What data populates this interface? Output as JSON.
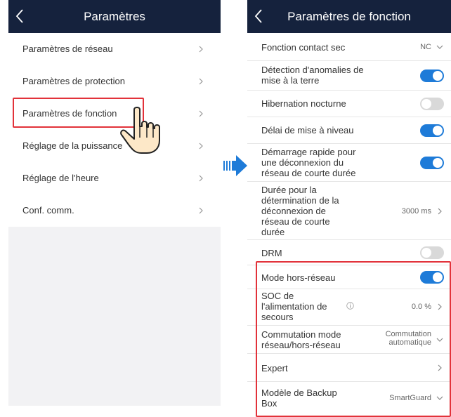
{
  "left": {
    "title": "Paramètres",
    "items": [
      {
        "label": "Paramètres de réseau"
      },
      {
        "label": "Paramètres de protection"
      },
      {
        "label": "Paramètres de fonction"
      },
      {
        "label": "Réglage de la puissance"
      },
      {
        "label": "Réglage de l'heure"
      },
      {
        "label": "Conf. comm."
      }
    ]
  },
  "right": {
    "title": "Paramètres de fonction",
    "rows": [
      {
        "label": "Fonction contact sec",
        "value": "NC",
        "control": "dropdown"
      },
      {
        "label": "Détection d'anomalies de mise à la terre",
        "control": "toggle",
        "state": "on"
      },
      {
        "label": "Hibernation nocturne",
        "control": "toggle",
        "state": "off"
      },
      {
        "label": "Délai de mise à niveau",
        "control": "toggle",
        "state": "on"
      },
      {
        "label": "Démarrage rapide pour une déconnexion du réseau de courte durée",
        "control": "toggle",
        "state": "on"
      },
      {
        "label": "Durée pour la détermination de la déconnexion de réseau de courte durée",
        "value": "3000 ms",
        "control": "chevron"
      },
      {
        "label": "DRM",
        "control": "toggle",
        "state": "off"
      },
      {
        "label": "Mode hors-réseau",
        "control": "toggle",
        "state": "on"
      },
      {
        "label": "SOC de l'alimentation de secours",
        "value": "0.0 %",
        "control": "chevron",
        "icon": "info-icon"
      },
      {
        "label": "Commutation mode réseau/hors-réseau",
        "value": "Commutation automatique",
        "control": "dropdown"
      },
      {
        "label": "Expert",
        "control": "chevron"
      },
      {
        "label": "Modèle de Backup Box",
        "value": "SmartGuard",
        "control": "dropdown"
      }
    ]
  },
  "colors": {
    "appbar": "#15223d",
    "toggle_on": "#1e7bd8",
    "toggle_off": "#d9d9d9",
    "highlight": "#e2323a",
    "arrow": "#1e7bd8"
  }
}
